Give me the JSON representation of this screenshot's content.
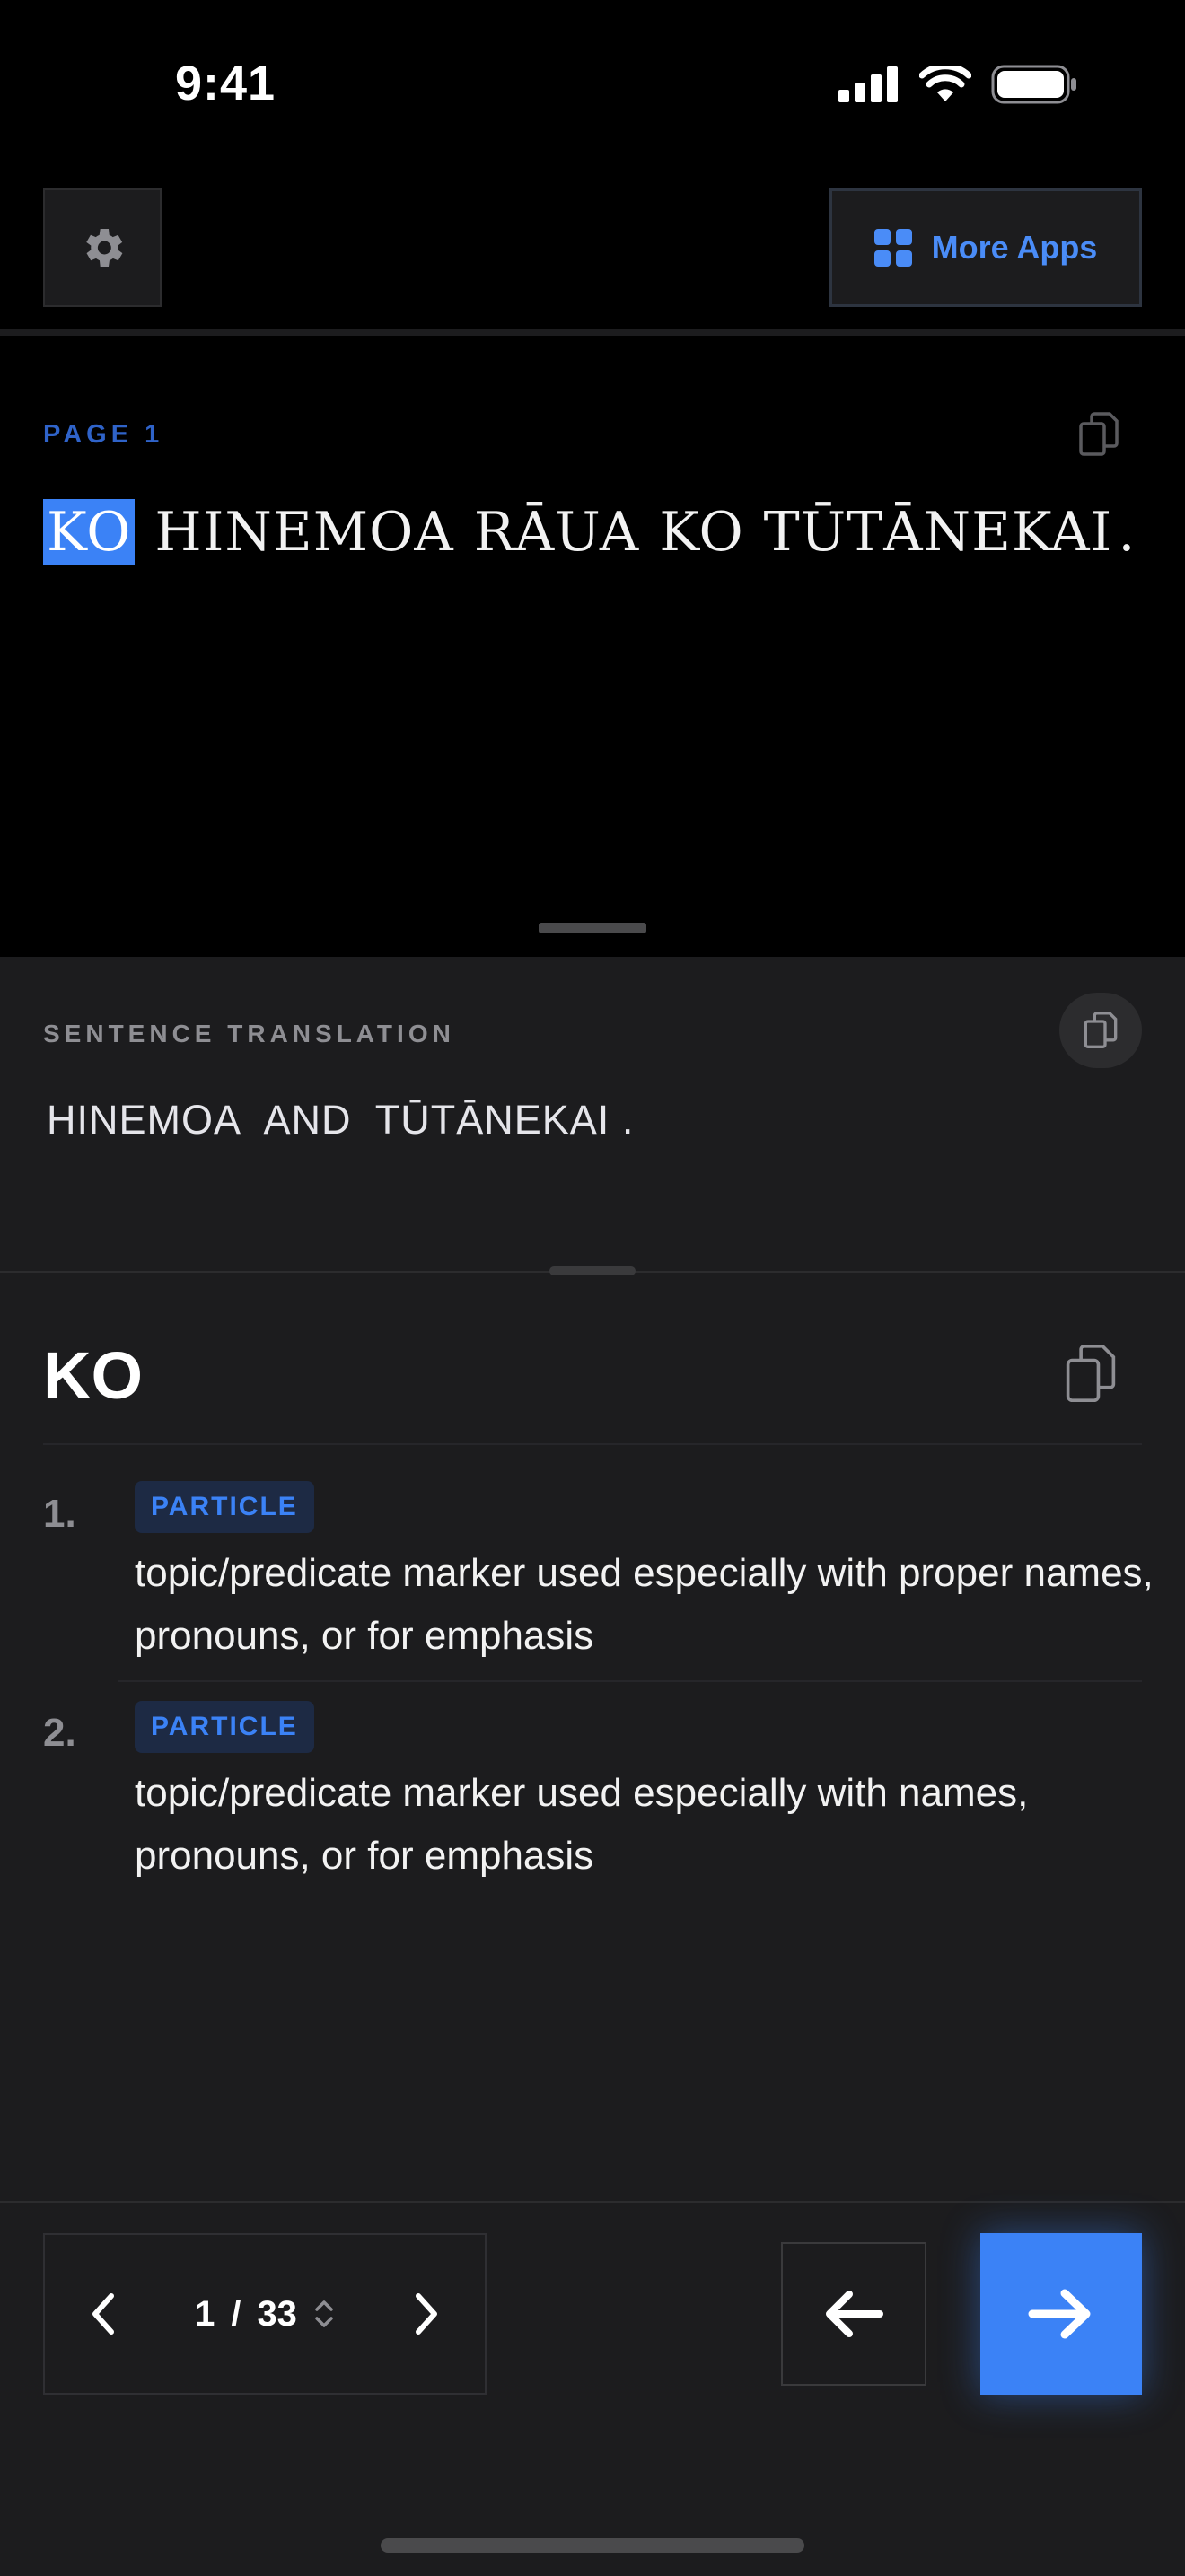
{
  "status_bar": {
    "time": "9:41",
    "icons": [
      "cellular-signal-icon",
      "wifi-icon",
      "battery-icon"
    ]
  },
  "toolbar": {
    "settings_icon": "gear-icon",
    "more_apps_label": "More Apps",
    "more_apps_icon": "grid-icon"
  },
  "reader": {
    "page_label": "PAGE 1",
    "words": [
      "KO",
      "HINEMOA",
      "RĀUA",
      "KO",
      "TŪTĀNEKAI",
      "."
    ],
    "highlighted_index": 0,
    "copy_icon": "copy-icon"
  },
  "translation": {
    "label": "SENTENCE TRANSLATION",
    "words": [
      "HINEMOA",
      "AND",
      "TŪTĀNEKAI",
      "."
    ],
    "copy_icon": "copy-icon"
  },
  "definition": {
    "headword": "KO",
    "copy_icon": "copy-icon",
    "senses": [
      {
        "number": "1.",
        "pos": "PARTICLE",
        "text": "topic/predicate marker used especially with proper names, pronouns, or for emphasis"
      },
      {
        "number": "2.",
        "pos": "PARTICLE",
        "text": "topic/predicate marker used especially with names, pronouns, or for emphasis"
      }
    ]
  },
  "navigation": {
    "current_page": "1",
    "separator": "/",
    "total_pages": "33",
    "back_icon": "arrow-left-icon",
    "next_icon": "arrow-right-icon"
  },
  "colors": {
    "accent": "#3b82f6",
    "background": "#000000",
    "panel": "#1c1c1e",
    "muted": "#8e8e93"
  }
}
